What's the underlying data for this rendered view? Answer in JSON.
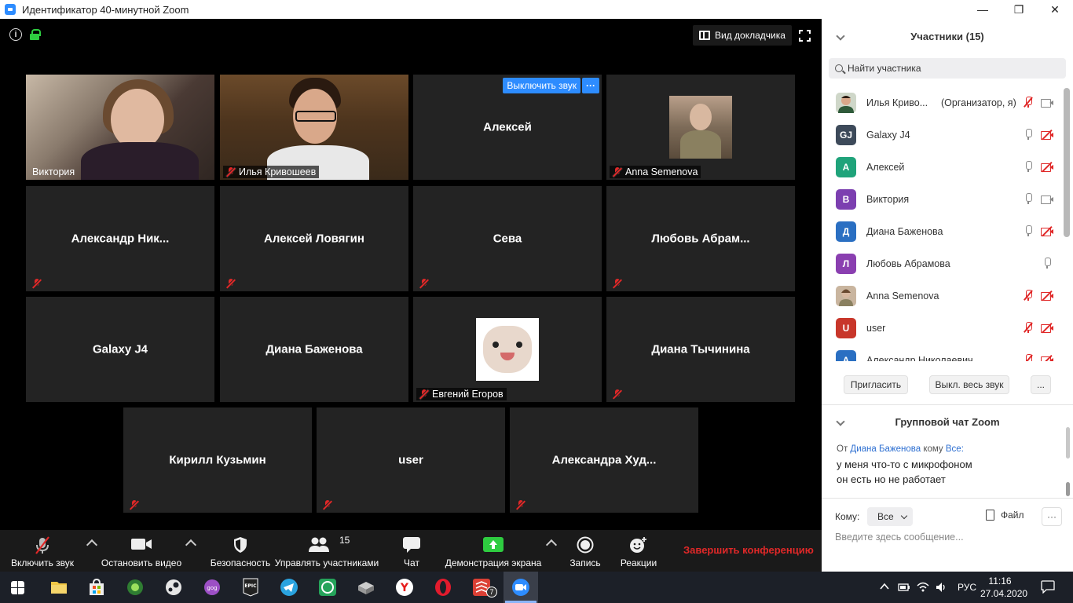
{
  "window": {
    "title": "Идентификатор 40-минутной Zoom",
    "minimize": "—",
    "restore": "❐",
    "close": "✕"
  },
  "meeting": {
    "speaker_view_label": "Вид докладчика",
    "tiles": [
      {
        "name": "Виктория",
        "label": "Виктория",
        "kind": "video-viktoria",
        "muted": false,
        "active": true
      },
      {
        "name": "Илья Кривошеев",
        "label": "Илья Кривошеев",
        "kind": "video-ilya",
        "muted": true
      },
      {
        "name": "Алексей",
        "center": "Алексей",
        "kind": "name",
        "muted": false,
        "hover": true
      },
      {
        "name": "Anna Semenova",
        "label": "Anna Semenova",
        "kind": "avatar-photo",
        "muted": true
      },
      {
        "name": "Александр Ник...",
        "center": "Александр  Ник...",
        "kind": "name",
        "muted": true
      },
      {
        "name": "Алексей Ловягин",
        "center": "Алексей Ловягин",
        "kind": "name",
        "muted": true
      },
      {
        "name": "Сева",
        "center": "Сева",
        "kind": "name",
        "muted": true
      },
      {
        "name": "Любовь Абрам...",
        "center": "Любовь  Абрам...",
        "kind": "name",
        "muted": true
      },
      {
        "name": "Galaxy J4",
        "center": "Galaxy J4",
        "kind": "name",
        "muted": false
      },
      {
        "name": "Диана Баженова",
        "center": "Диана Баженова",
        "kind": "name",
        "muted": false
      },
      {
        "name": "Евгений Егоров",
        "label": "Евгений Егоров",
        "kind": "cat-photo",
        "muted": true
      },
      {
        "name": "Диана Тычинина",
        "center": "Диана Тычинина",
        "kind": "name",
        "muted": true
      },
      {
        "name": "Кирилл Кузьмин",
        "center": "Кирилл Кузьмин",
        "kind": "name",
        "muted": true
      },
      {
        "name": "user",
        "center": "user",
        "kind": "name",
        "muted": true
      },
      {
        "name": "Александра Худ...",
        "center": "Александра  Худ...",
        "kind": "name",
        "muted": true
      }
    ],
    "hover_mute_label": "Выключить звук",
    "hover_more_label": "···"
  },
  "toolbar": {
    "unmute": "Включить звук",
    "stop_video": "Остановить видео",
    "security": "Безопасность",
    "manage_participants": "Управлять участниками",
    "participant_count": "15",
    "chat": "Чат",
    "share_screen": "Демонстрация экрана",
    "record": "Запись",
    "reactions": "Реакции",
    "end_meeting": "Завершить конференцию"
  },
  "participants_panel": {
    "title": "Участники (15)",
    "search_placeholder": "Найти участника",
    "list": [
      {
        "name": "Илья Криво...",
        "role": "(Организатор, я)",
        "initials": "",
        "color": "#6a8a6a",
        "mic": "off",
        "cam": "on",
        "photo": true
      },
      {
        "name": "Galaxy J4",
        "initials": "GJ",
        "color": "#3d4a5a",
        "mic": "on",
        "cam": "off"
      },
      {
        "name": "Алексей",
        "initials": "А",
        "color": "#1fa37a",
        "mic": "on",
        "cam": "off"
      },
      {
        "name": "Виктория",
        "initials": "В",
        "color": "#7c3fb0",
        "mic": "on",
        "cam": "on"
      },
      {
        "name": "Диана Баженова",
        "initials": "Д",
        "color": "#2a6fc2",
        "mic": "on",
        "cam": "off"
      },
      {
        "name": "Любовь Абрамова",
        "initials": "Л",
        "color": "#8a3fb0",
        "mic": "on",
        "cam": "none"
      },
      {
        "name": "Anna Semenova",
        "initials": "",
        "color": "#9a7b60",
        "mic": "off",
        "cam": "off",
        "photo": true
      },
      {
        "name": "user",
        "initials": "U",
        "color": "#c8362a",
        "mic": "off",
        "cam": "off"
      },
      {
        "name": "Александр Николаевич",
        "initials": "А",
        "color": "#2a6fc2",
        "mic": "off",
        "cam": "off"
      }
    ],
    "invite_label": "Пригласить",
    "mute_all_label": "Выкл. весь звук",
    "more_label": "..."
  },
  "chat": {
    "title": "Групповой чат Zoom",
    "from_prefix": "От",
    "from_name": "Диана Баженова",
    "to_word": "кому",
    "to_name": "Все:",
    "messages": [
      "у меня что-то с микрофоном",
      "он есть но не работает"
    ],
    "to_label": "Кому:",
    "to_value": "Все",
    "file_label": "Файл",
    "more_label": "···",
    "input_placeholder": "Введите здесь сообщение..."
  },
  "taskbar": {
    "language": "РУС",
    "time": "11:16",
    "date": "27.04.2020",
    "badge_count": "7"
  },
  "colors": {
    "accent_blue": "#2d8cff",
    "active_speaker": "#d7f06b",
    "muted_red": "#e02828",
    "end_red": "#e02828",
    "share_green": "#2ecc40"
  }
}
